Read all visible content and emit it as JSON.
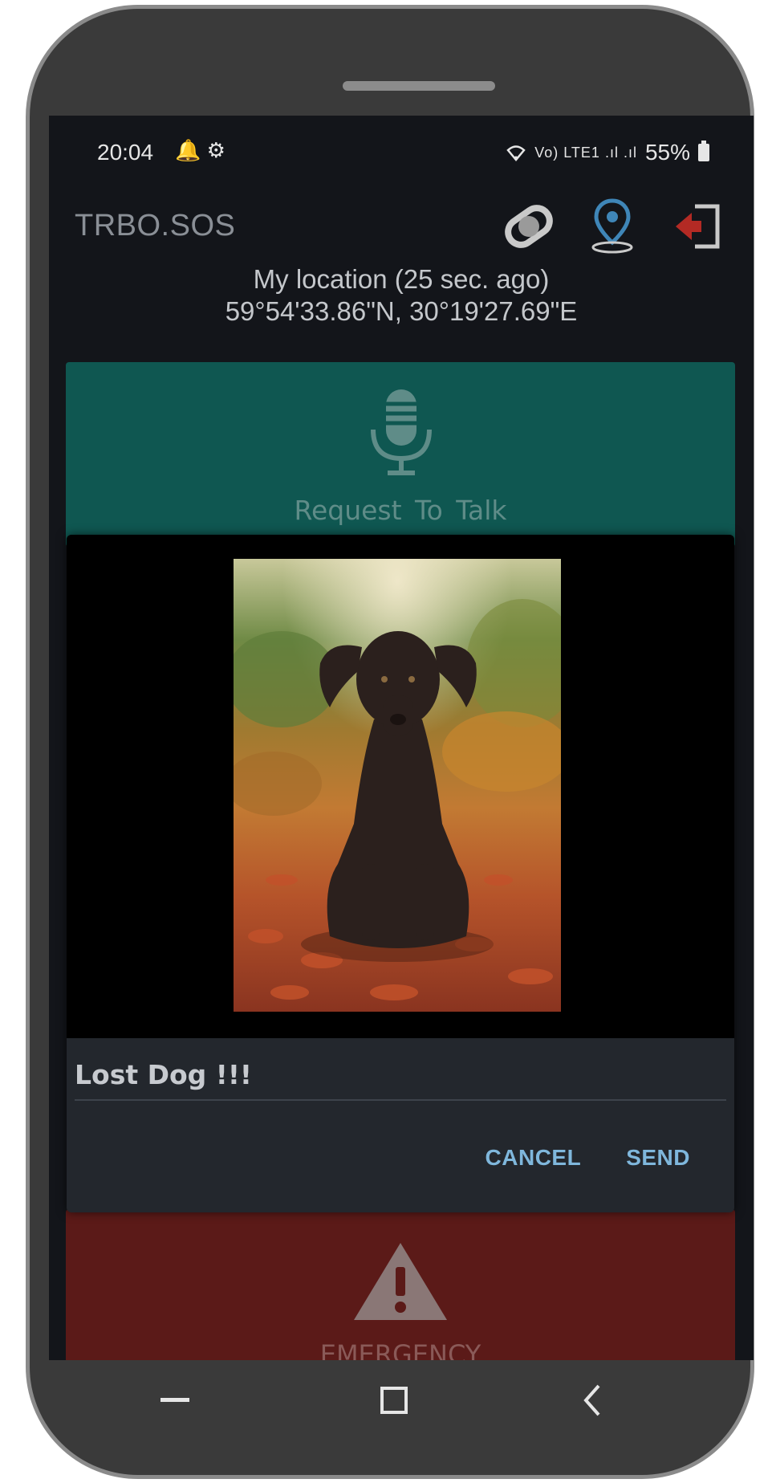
{
  "status_bar": {
    "time": "20:04",
    "left_icons": "🔔 ⚙",
    "network": "Vo) LTE1 .ıl .ıl",
    "battery": "55%"
  },
  "app_bar": {
    "title": "TRBO.SOS",
    "icons": [
      "sync-icon",
      "location-pin-icon",
      "exit-icon"
    ]
  },
  "location": {
    "label": "My location (25 sec. ago)",
    "coordinates": "59°54'33.86\"N, 30°19'27.69\"E"
  },
  "request_to_talk": {
    "label": "Request To Talk",
    "icon": "microphone-icon"
  },
  "dialog": {
    "caption": "Lost Dog !!!",
    "cancel_label": "CANCEL",
    "send_label": "SEND"
  },
  "emergency": {
    "label": "EMERGENCY",
    "icon": "warning-icon"
  },
  "colors": {
    "accent_teal": "#0f5751",
    "emergency_red": "#5b1a18",
    "button_blue": "#7fb7dc",
    "location_pin": "#3f86b8",
    "exit_red": "#b32a24"
  },
  "nav": {
    "icons": [
      "recent-apps-icon",
      "home-icon",
      "back-icon"
    ]
  }
}
